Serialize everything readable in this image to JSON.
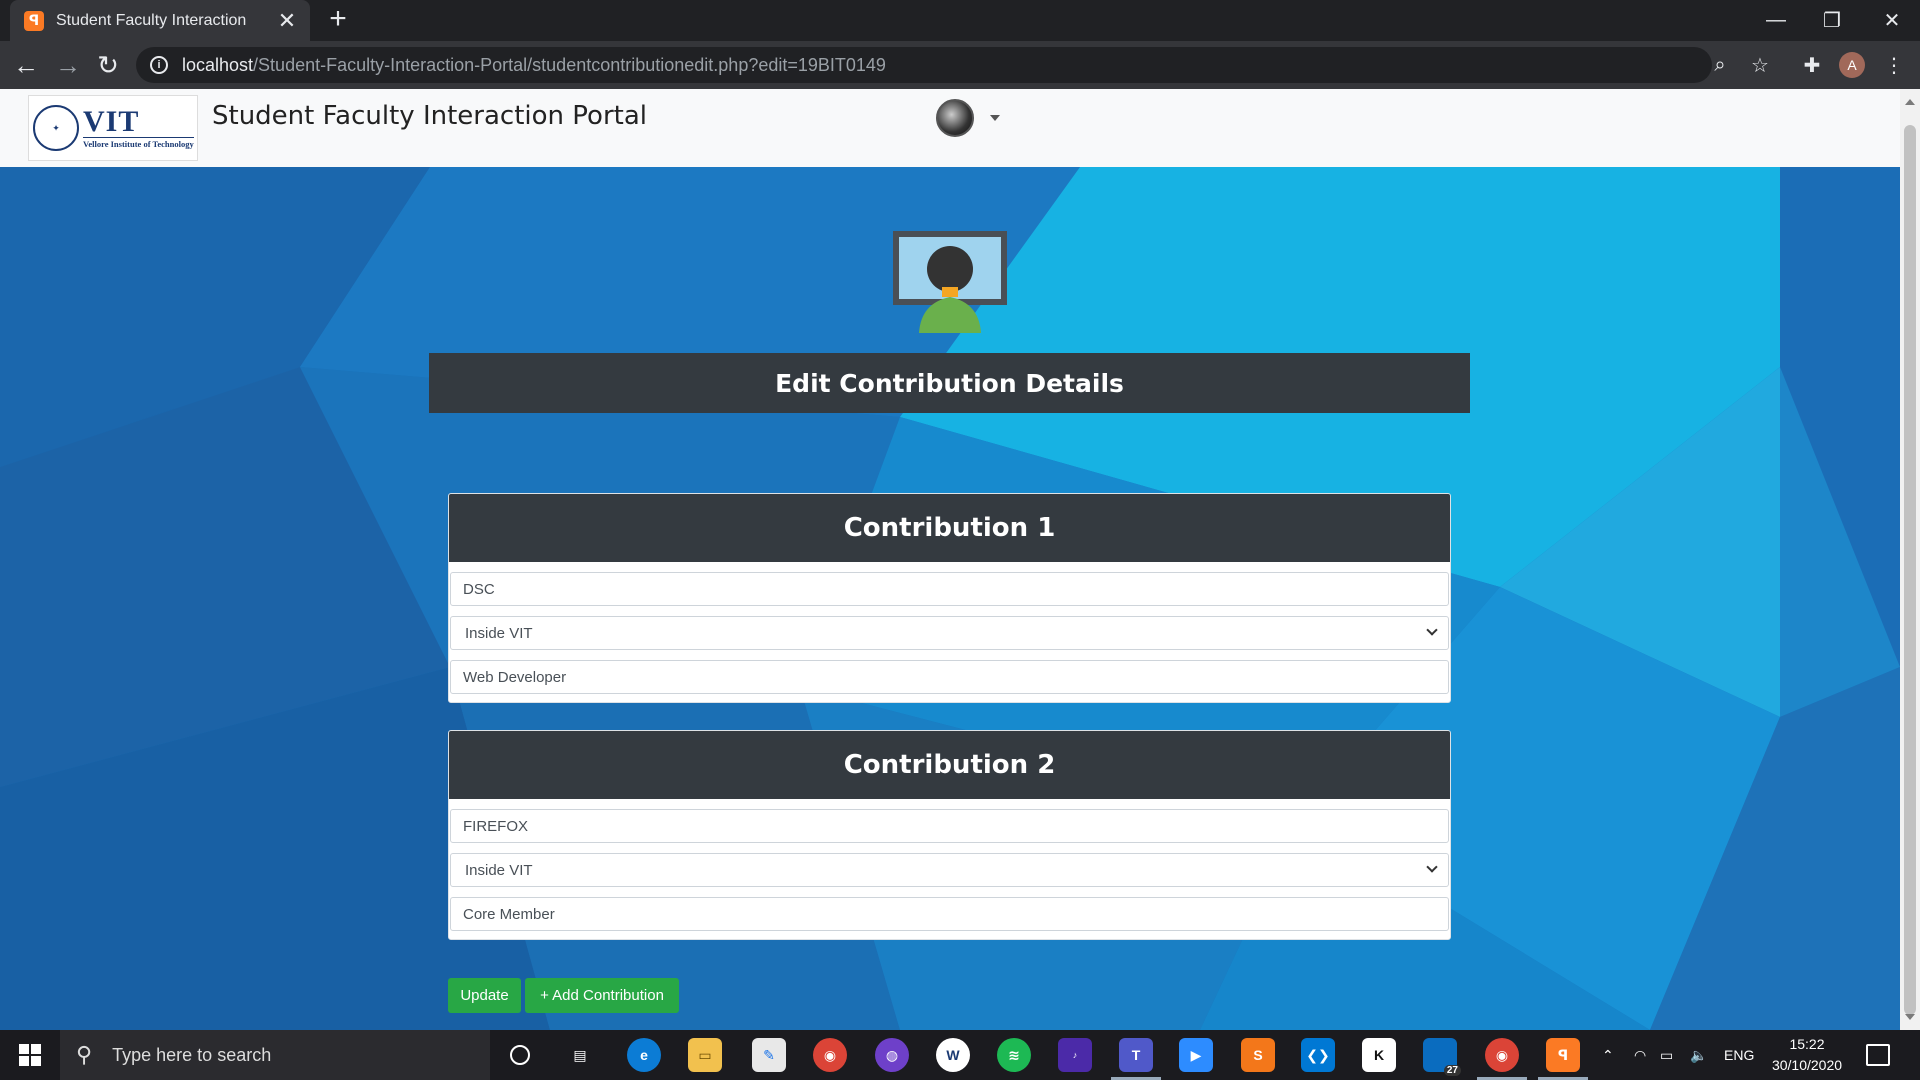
{
  "browser": {
    "tab_title": "Student Faculty Interaction",
    "tab_close": "✕",
    "new_tab": "+",
    "url_host": "localhost",
    "url_path": "/Student-Faculty-Interaction-Portal/studentcontributionedit.php?edit=19BIT0149",
    "profile_initial": "A"
  },
  "navbar": {
    "logo_main": "VIT",
    "logo_sub": "Vellore Institute of Technology",
    "brand_title": "Student Faculty Interaction Portal"
  },
  "page": {
    "heading": "Edit Contribution Details",
    "contributions": [
      {
        "title": "Contribution 1",
        "name": "DSC",
        "place": "Inside VIT",
        "role": "Web Developer"
      },
      {
        "title": "Contribution 2",
        "name": "FIREFOX",
        "place": "Inside VIT",
        "role": "Core Member"
      }
    ],
    "update_label": "Update",
    "add_label": "+ Add Contribution"
  },
  "taskbar": {
    "search_placeholder": "Type here to search",
    "lang": "ENG",
    "time": "15:22",
    "date": "30/10/2020",
    "badge_count": "27"
  },
  "colors": {
    "dark_header": "#343a40",
    "button_green": "#28a745",
    "background_blue": "#1a6fb8"
  }
}
